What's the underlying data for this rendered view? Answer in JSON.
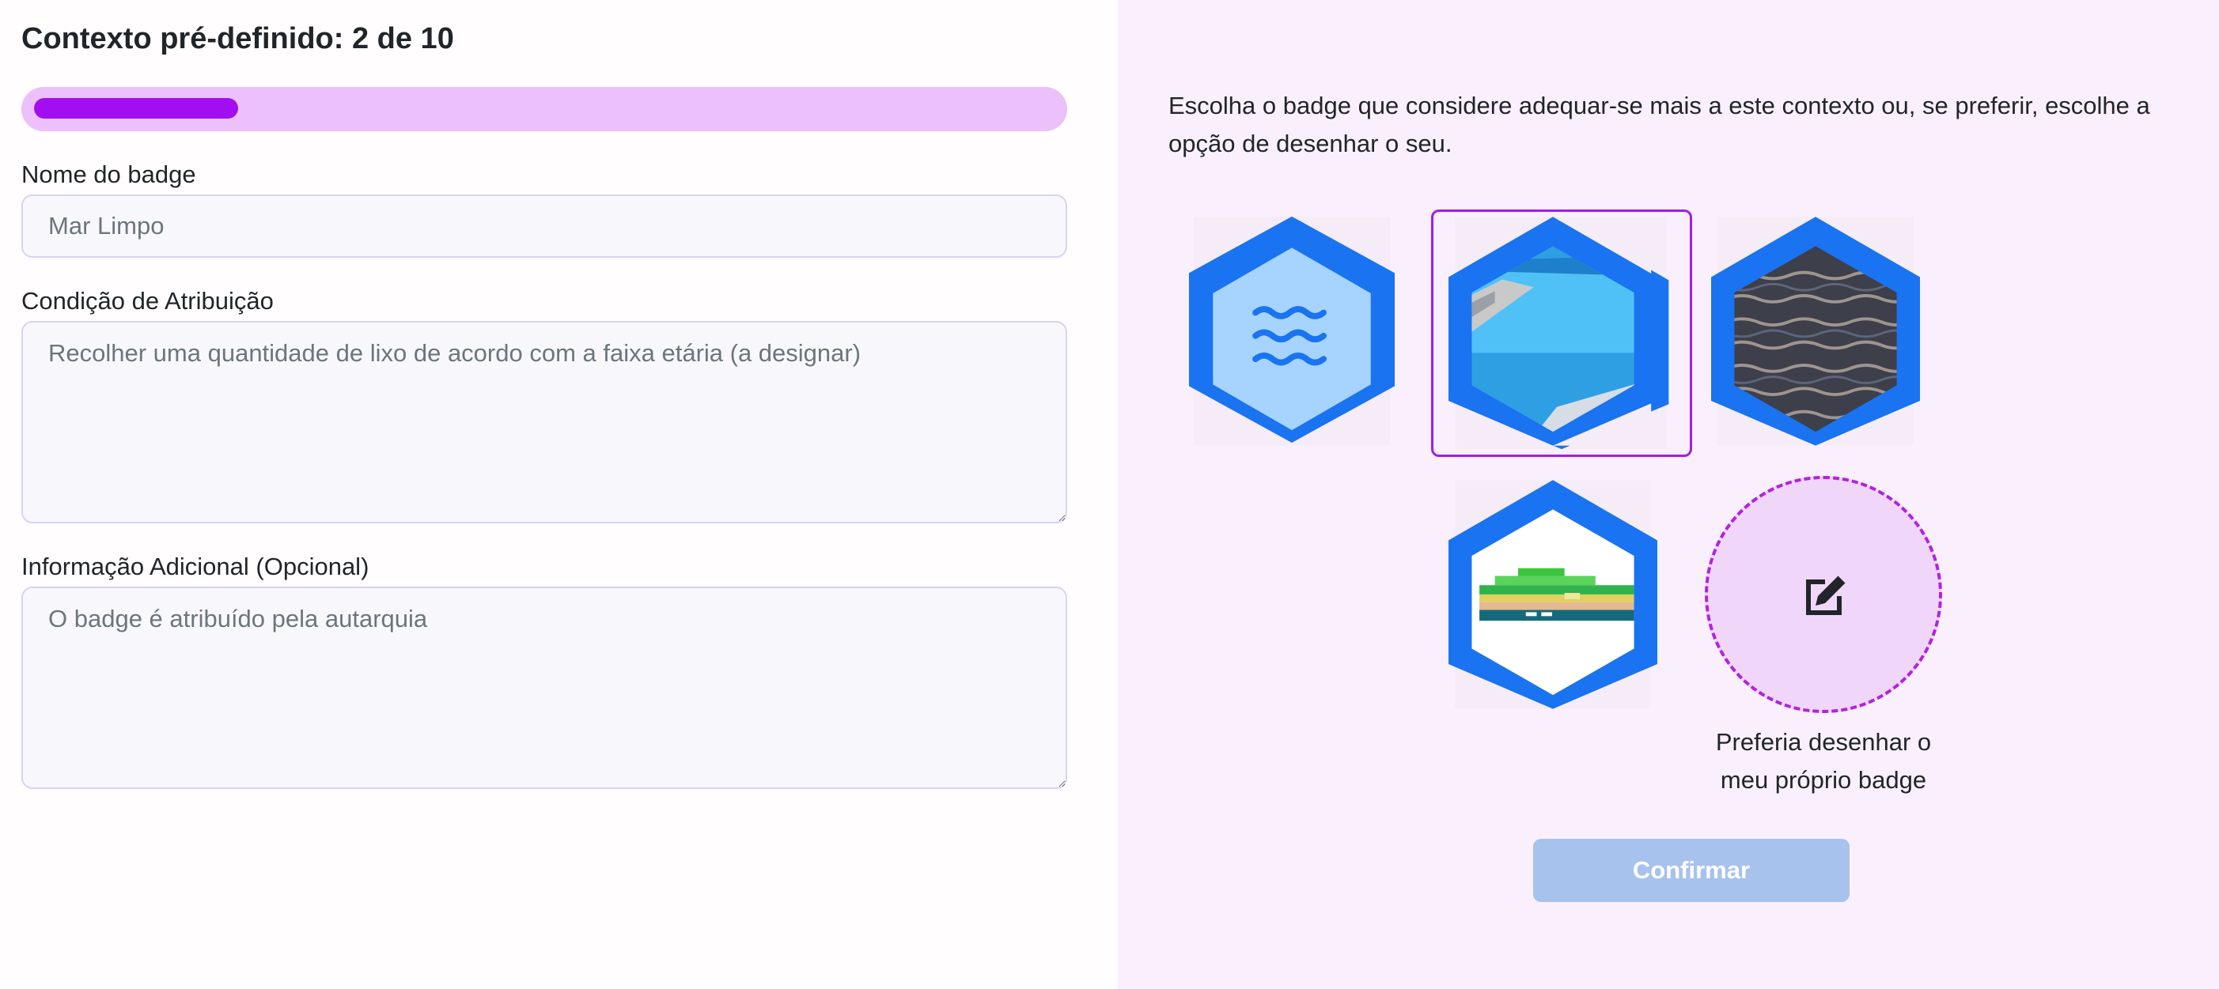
{
  "header": {
    "title": "Contexto pré-definido: 2 de 10"
  },
  "progress": {
    "current": 2,
    "total": 10,
    "fraction": 0.2,
    "fill_color": "#a20ef0",
    "track_color": "#ebc0fb"
  },
  "form": {
    "name_label": "Nome do badge",
    "name_placeholder": "Mar Limpo",
    "condition_label": "Condição de Atribuição",
    "condition_placeholder": "Recolher uma quantidade de lixo de acordo com a faixa etária (a designar)",
    "info_label": "Informação Adicional (Opcional)",
    "info_placeholder": "O badge é atribuído pela autarquia"
  },
  "chooser": {
    "intro": "Escolha o badge que considere adequar-se mais a este contexto ou, se preferir, escolhe a opção de desenhar o seu.",
    "badges": [
      {
        "icon": "waves-badge-icon",
        "selected": false
      },
      {
        "icon": "sailboat-badge-icon",
        "selected": true
      },
      {
        "icon": "sea-cliff-badge-icon",
        "selected": false
      },
      {
        "icon": "ocean-water-badge-icon",
        "selected": false
      },
      {
        "icon": "coastline-badge-icon",
        "selected": false
      }
    ],
    "draw_icon": "edit-pencil-icon",
    "draw_caption_line1": "Preferia desenhar o",
    "draw_caption_line2": "meu próprio badge",
    "confirm_label": "Confirmar"
  },
  "colors": {
    "badge_frame": "#1a73f0",
    "selected_border": "#a31ce8",
    "confirm_disabled": "#a7c2ec",
    "panel_bg": "#faf0fd"
  }
}
